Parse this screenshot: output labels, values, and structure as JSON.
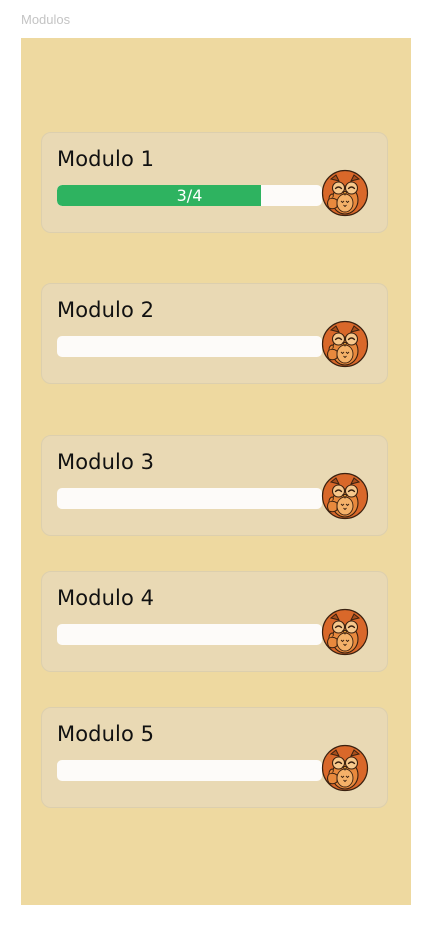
{
  "frame": {
    "label": "Modulos"
  },
  "colors": {
    "panel_background": "#eed9a0",
    "card_background": "#e9d9b4",
    "progress_fill": "#2eb360",
    "progress_track": "#fdfbf9",
    "owl_body": "#e0782f"
  },
  "modules": [
    {
      "title": "Modulo 1",
      "progress_text": "3/4",
      "progress": 0.77,
      "icon": "owl-thumbs-up-icon"
    },
    {
      "title": "Modulo 2",
      "progress_text": "",
      "progress": 0,
      "icon": "owl-thumbs-up-icon"
    },
    {
      "title": "Modulo 3",
      "progress_text": "",
      "progress": 0,
      "icon": "owl-thumbs-up-icon"
    },
    {
      "title": "Modulo 4",
      "progress_text": "",
      "progress": 0,
      "icon": "owl-thumbs-up-icon"
    },
    {
      "title": "Modulo 5",
      "progress_text": "",
      "progress": 0,
      "icon": "owl-thumbs-up-icon"
    }
  ]
}
